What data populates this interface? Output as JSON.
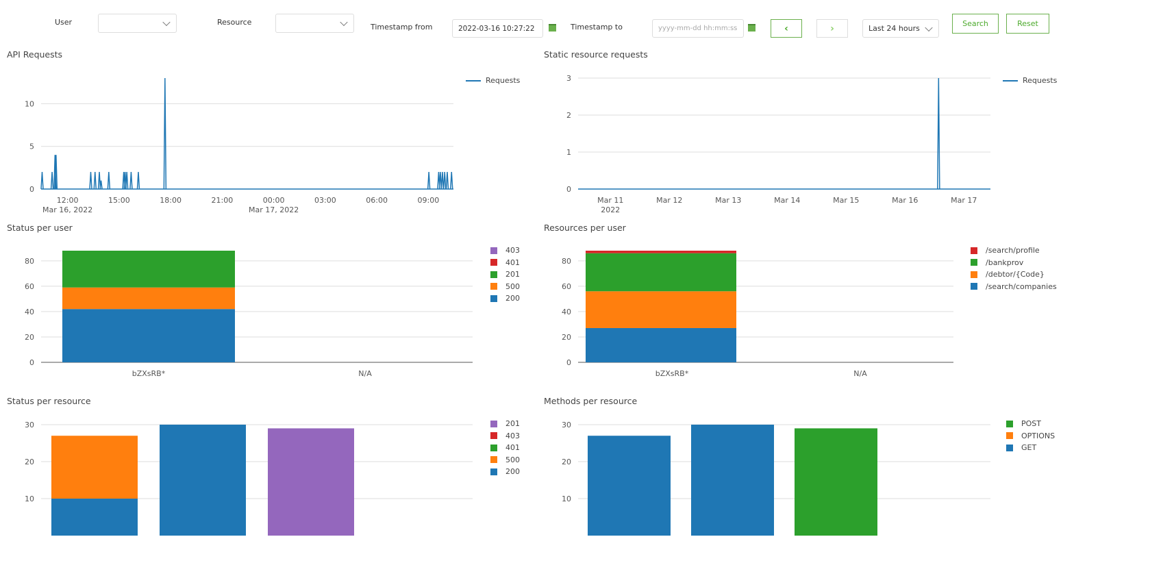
{
  "filters": {
    "user_label": "User",
    "user_value": "",
    "resource_label": "Resource",
    "resource_value": "",
    "timestamp_from_label": "Timestamp from",
    "timestamp_from_value": "2022-03-16 10:27:22",
    "timestamp_to_label": "Timestamp to",
    "timestamp_to_value": "",
    "timestamp_to_placeholder": "yyyy-mm-dd hh:mm:ss",
    "prev_icon": "‹",
    "next_icon": "›",
    "range_value": "Last 24 hours",
    "search_label": "Search",
    "reset_label": "Reset",
    "accent_color": "#6ab04c"
  },
  "chart_data": [
    {
      "id": "api-requests",
      "type": "line",
      "title": "API Requests",
      "legend": [
        "Requests"
      ],
      "color": "#1f77b4",
      "x_unit": "hours since 2022-03-16 00:00",
      "xlim": [
        10.46,
        34.46
      ],
      "ylim": [
        0,
        13
      ],
      "yticks": [
        0,
        5,
        10
      ],
      "xticks": [
        {
          "x": 12,
          "label": "12:00",
          "sub": "Mar 16, 2022"
        },
        {
          "x": 15,
          "label": "15:00"
        },
        {
          "x": 18,
          "label": "18:00"
        },
        {
          "x": 21,
          "label": "21:00"
        },
        {
          "x": 24,
          "label": "00:00",
          "sub": "Mar 17, 2022"
        },
        {
          "x": 27,
          "label": "03:00"
        },
        {
          "x": 30,
          "label": "06:00"
        },
        {
          "x": 33,
          "label": "09:00"
        }
      ],
      "spikes": [
        {
          "x": 10.52,
          "y": 2
        },
        {
          "x": 11.1,
          "y": 2
        },
        {
          "x": 11.27,
          "y": 4
        },
        {
          "x": 11.33,
          "y": 4
        },
        {
          "x": 13.35,
          "y": 2
        },
        {
          "x": 13.6,
          "y": 2
        },
        {
          "x": 13.85,
          "y": 2
        },
        {
          "x": 13.95,
          "y": 1
        },
        {
          "x": 14.4,
          "y": 2
        },
        {
          "x": 15.27,
          "y": 2
        },
        {
          "x": 15.35,
          "y": 2
        },
        {
          "x": 15.45,
          "y": 2
        },
        {
          "x": 15.7,
          "y": 2
        },
        {
          "x": 16.12,
          "y": 2
        },
        {
          "x": 17.67,
          "y": 13
        },
        {
          "x": 33.03,
          "y": 2
        },
        {
          "x": 33.6,
          "y": 2
        },
        {
          "x": 33.7,
          "y": 2
        },
        {
          "x": 33.82,
          "y": 2
        },
        {
          "x": 33.95,
          "y": 2
        },
        {
          "x": 34.1,
          "y": 2
        },
        {
          "x": 34.35,
          "y": 2
        }
      ]
    },
    {
      "id": "static-requests",
      "type": "line",
      "title": "Static resource requests",
      "legend": [
        "Requests"
      ],
      "color": "#1f77b4",
      "x_unit": "days since 2022-03-11",
      "xlim": [
        -0.55,
        6.45
      ],
      "ylim": [
        0,
        3
      ],
      "yticks": [
        0,
        1,
        2,
        3
      ],
      "xticks": [
        {
          "x": 0,
          "label": "Mar 11",
          "sub": "2022"
        },
        {
          "x": 1,
          "label": "Mar 12"
        },
        {
          "x": 2,
          "label": "Mar 13"
        },
        {
          "x": 3,
          "label": "Mar 14"
        },
        {
          "x": 4,
          "label": "Mar 15"
        },
        {
          "x": 5,
          "label": "Mar 16"
        },
        {
          "x": 6,
          "label": "Mar 17"
        }
      ],
      "spikes": [
        {
          "x": 5.57,
          "y": 3
        }
      ]
    },
    {
      "id": "status-per-user",
      "type": "bar",
      "stacked": true,
      "title": "Status per user",
      "categories": [
        "bZXsRB*",
        "N/A"
      ],
      "ylim": [
        0,
        88
      ],
      "yticks": [
        0,
        20,
        40,
        60,
        80
      ],
      "legend_order": [
        "403",
        "401",
        "201",
        "500",
        "200"
      ],
      "series": [
        {
          "name": "200",
          "color": "#1f77b4",
          "values": [
            42,
            0
          ]
        },
        {
          "name": "500",
          "color": "#ff7f0e",
          "values": [
            17,
            0
          ]
        },
        {
          "name": "201",
          "color": "#2ca02c",
          "values": [
            29,
            0
          ]
        },
        {
          "name": "401",
          "color": "#d62728",
          "values": [
            0,
            0
          ]
        },
        {
          "name": "403",
          "color": "#9467bd",
          "values": [
            0,
            0
          ]
        }
      ]
    },
    {
      "id": "resources-per-user",
      "type": "bar",
      "stacked": true,
      "title": "Resources per user",
      "categories": [
        "bZXsRB*",
        "N/A"
      ],
      "ylim": [
        0,
        88
      ],
      "yticks": [
        0,
        20,
        40,
        60,
        80
      ],
      "legend_order": [
        "/search/profile",
        "/bankprov",
        "/debtor/{Code}",
        "/search/companies"
      ],
      "series": [
        {
          "name": "/search/companies",
          "color": "#1f77b4",
          "values": [
            27,
            0
          ]
        },
        {
          "name": "/debtor/{Code}",
          "color": "#ff7f0e",
          "values": [
            29,
            0
          ]
        },
        {
          "name": "/bankprov",
          "color": "#2ca02c",
          "values": [
            30,
            0
          ]
        },
        {
          "name": "/search/profile",
          "color": "#d62728",
          "values": [
            2,
            0
          ]
        }
      ]
    },
    {
      "id": "status-per-resource",
      "type": "bar",
      "stacked": true,
      "title": "Status per resource",
      "categories": [
        "",
        "",
        ""
      ],
      "ylim": [
        0,
        30
      ],
      "yticks": [
        10,
        20,
        30
      ],
      "legend_order": [
        "201",
        "403",
        "401",
        "500",
        "200"
      ],
      "series": [
        {
          "name": "200",
          "color": "#1f77b4",
          "values": [
            10,
            30,
            0
          ]
        },
        {
          "name": "500",
          "color": "#ff7f0e",
          "values": [
            17,
            0,
            0
          ]
        },
        {
          "name": "401",
          "color": "#2ca02c",
          "values": [
            0,
            0,
            0
          ]
        },
        {
          "name": "403",
          "color": "#d62728",
          "values": [
            0,
            0,
            0
          ]
        },
        {
          "name": "201",
          "color": "#9467bd",
          "values": [
            0,
            0,
            29
          ]
        }
      ]
    },
    {
      "id": "methods-per-resource",
      "type": "bar",
      "stacked": true,
      "title": "Methods per resource",
      "categories": [
        "",
        "",
        ""
      ],
      "ylim": [
        0,
        30
      ],
      "yticks": [
        10,
        20,
        30
      ],
      "legend_order": [
        "POST",
        "OPTIONS",
        "GET"
      ],
      "series": [
        {
          "name": "GET",
          "color": "#1f77b4",
          "values": [
            27,
            30,
            0
          ]
        },
        {
          "name": "OPTIONS",
          "color": "#ff7f0e",
          "values": [
            0,
            0,
            0
          ]
        },
        {
          "name": "POST",
          "color": "#2ca02c",
          "values": [
            0,
            0,
            29
          ]
        }
      ]
    }
  ]
}
